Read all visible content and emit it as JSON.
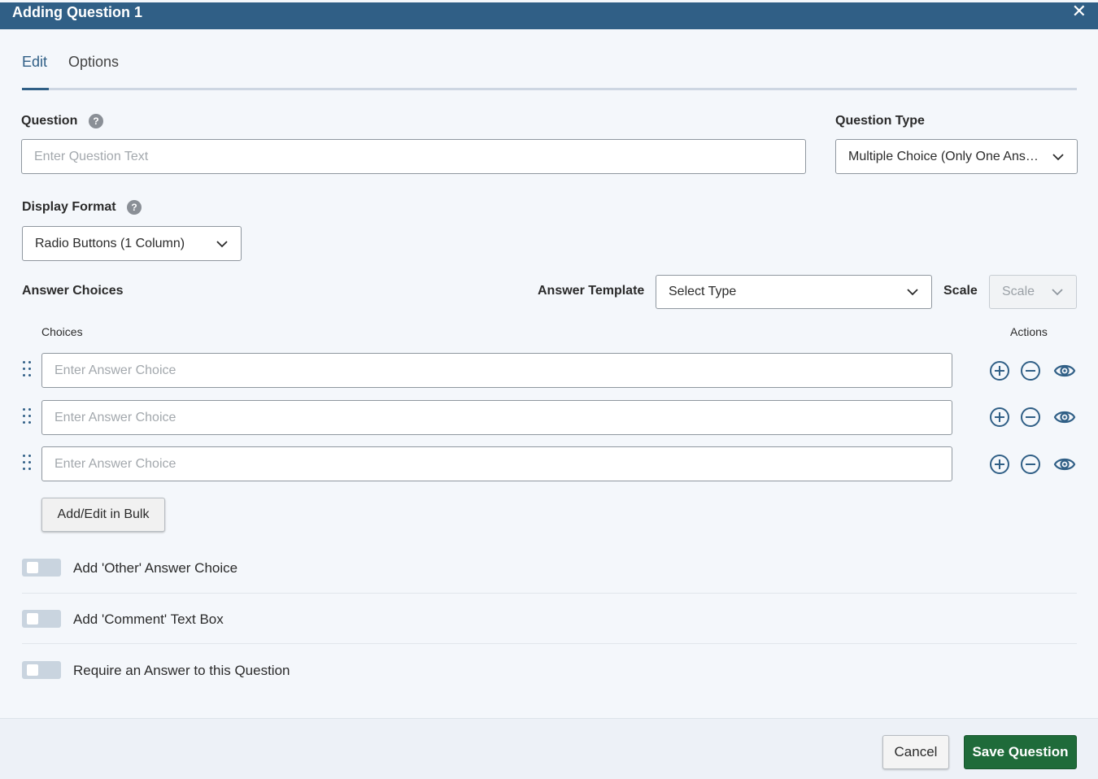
{
  "dialog": {
    "title": "Adding Question 1",
    "close_label": "✕"
  },
  "tabs": [
    {
      "label": "Edit",
      "active": true
    },
    {
      "label": "Options",
      "active": false
    }
  ],
  "question": {
    "label": "Question",
    "help": "?",
    "placeholder": "Enter Question Text",
    "value": ""
  },
  "question_type": {
    "label": "Question Type",
    "value": "Multiple Choice (Only One Answer)"
  },
  "display_format": {
    "label": "Display Format",
    "help": "?",
    "value": "Radio Buttons (1 Column)"
  },
  "answer_choices": {
    "label": "Answer Choices",
    "template_label": "Answer Template",
    "template_value": "Select Type",
    "scale_label": "Scale",
    "scale_value": "Scale",
    "choices_header": "Choices",
    "actions_header": "Actions",
    "choices": [
      {
        "placeholder": "Enter Answer Choice",
        "value": ""
      },
      {
        "placeholder": "Enter Answer Choice",
        "value": ""
      },
      {
        "placeholder": "Enter Answer Choice",
        "value": ""
      }
    ],
    "bulk_button": "Add/Edit in Bulk"
  },
  "toggles": [
    {
      "label": "Add 'Other' Answer Choice",
      "on": false
    },
    {
      "label": "Add 'Comment' Text Box",
      "on": false
    },
    {
      "label": "Require an Answer to this Question",
      "on": false
    }
  ],
  "footer": {
    "cancel_label": "Cancel",
    "save_label": "Save Question"
  },
  "colors": {
    "header": "#305f86",
    "accent": "#305f86",
    "save": "#1f6b3a"
  },
  "icons": {
    "add": "plus-circle-icon",
    "remove": "minus-circle-icon",
    "visibility": "eye-icon",
    "drag": "drag-handle-icon",
    "help": "question-circle-icon",
    "dropdown": "chevron-down-icon",
    "close": "close-icon"
  }
}
